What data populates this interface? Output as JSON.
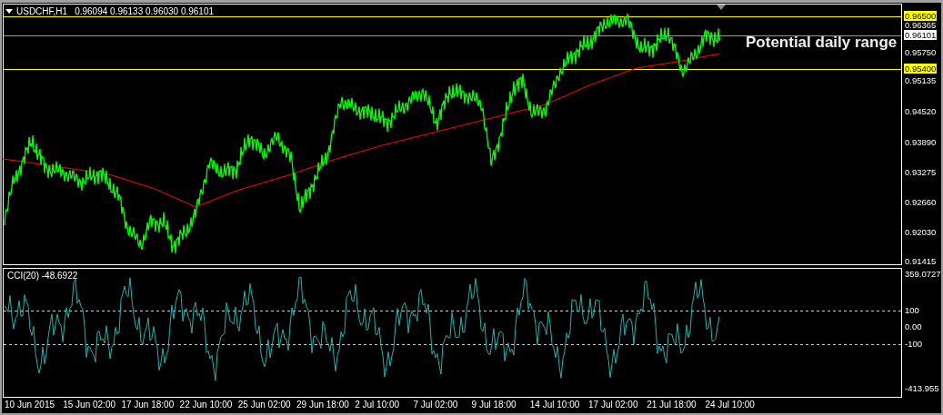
{
  "chart": {
    "symbol": "USDCHF,H1",
    "ohlc": "0.96094 0.96133 0.96030 0.96101",
    "annotation": "Potential daily range",
    "price_axis": [
      {
        "label": "0.96500",
        "kind": "marker",
        "color": "#ffff00"
      },
      {
        "label": "0.96365",
        "kind": "tick"
      },
      {
        "label": "0.96101",
        "kind": "marker",
        "color": "#ffffff"
      },
      {
        "label": "0.95750",
        "kind": "tick"
      },
      {
        "label": "0.95400",
        "kind": "marker",
        "color": "#ffff00"
      },
      {
        "label": "0.95135",
        "kind": "tick"
      },
      {
        "label": "0.94520",
        "kind": "tick"
      },
      {
        "label": "0.93890",
        "kind": "tick"
      },
      {
        "label": "0.93275",
        "kind": "tick"
      },
      {
        "label": "0.92660",
        "kind": "tick"
      },
      {
        "label": "0.92030",
        "kind": "tick"
      },
      {
        "label": "0.91415",
        "kind": "tick"
      }
    ]
  },
  "indicator": {
    "title": "CCI(20) -48.6922",
    "axis": [
      "359.0727",
      "100",
      "0.00",
      "-100",
      "-413.955"
    ]
  },
  "time_axis": [
    "10 Jun 2015",
    "15 Jun 02:00",
    "17 Jun 18:00",
    "22 Jun 10:00",
    "25 Jun 02:00",
    "29 Jun 18:00",
    "2 Jul 10:00",
    "7 Jul 02:00",
    "9 Jul 18:00",
    "14 Jul 10:00",
    "17 Jul 02:00",
    "21 Jul 18:00",
    "24 Jul 10:00"
  ]
}
